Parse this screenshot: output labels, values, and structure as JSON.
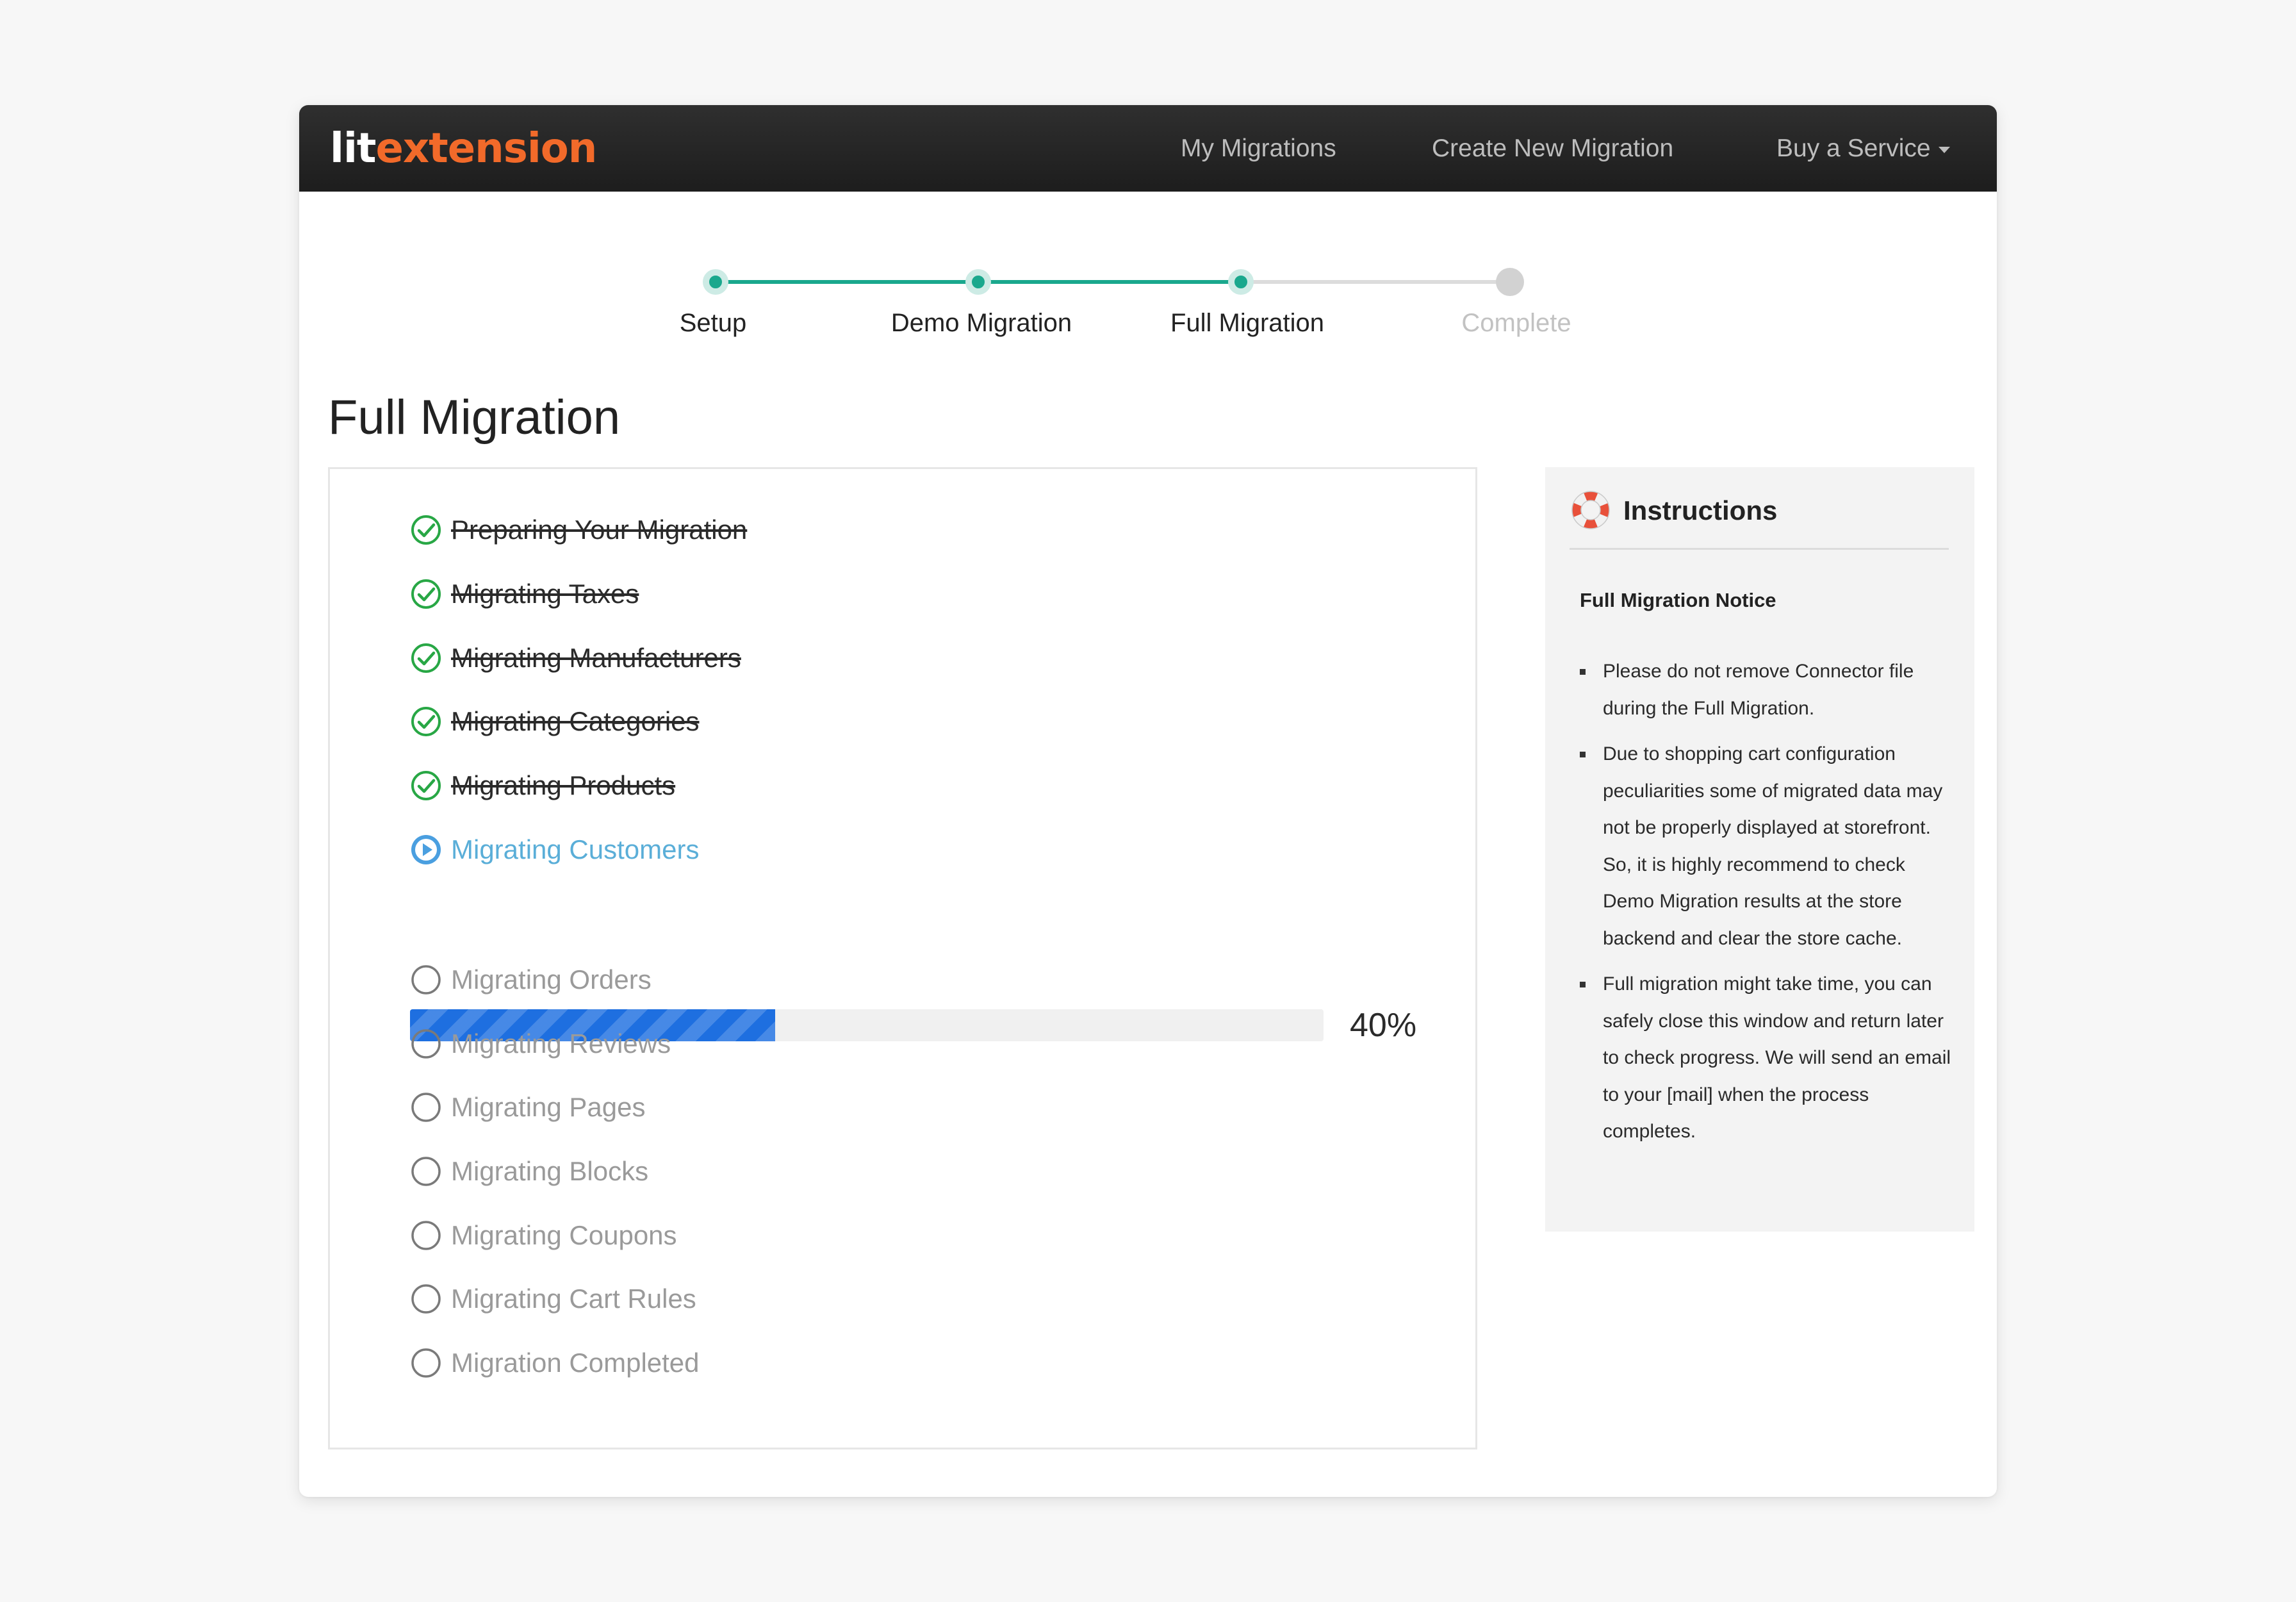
{
  "navbar": {
    "logo_prefix": "lit",
    "logo_suffix": "extension",
    "links": [
      "My Migrations",
      "Create New Migration",
      "Buy a Service"
    ]
  },
  "stepper": {
    "steps": [
      {
        "label": "Setup",
        "status": "done"
      },
      {
        "label": "Demo Migration",
        "status": "done"
      },
      {
        "label": "Full Migration",
        "status": "current"
      },
      {
        "label": "Complete",
        "status": "todo"
      }
    ]
  },
  "main": {
    "title": "Full Migration",
    "tasks": [
      {
        "label": "Preparing Your Migration",
        "status": "done"
      },
      {
        "label": "Migrating Taxes",
        "status": "done"
      },
      {
        "label": "Migrating Manufacturers",
        "status": "done"
      },
      {
        "label": "Migrating Categories",
        "status": "done"
      },
      {
        "label": "Migrating Products",
        "status": "done"
      },
      {
        "label": "Migrating Customers",
        "status": "active"
      },
      {
        "label": "Migrating Orders",
        "status": "pending"
      },
      {
        "label": "Migrating Reviews",
        "status": "pending"
      },
      {
        "label": "Migrating Pages",
        "status": "pending"
      },
      {
        "label": "Migrating Blocks",
        "status": "pending"
      },
      {
        "label": "Migrating Coupons",
        "status": "pending"
      },
      {
        "label": "Migrating Cart Rules",
        "status": "pending"
      },
      {
        "label": "Migration Completed",
        "status": "pending"
      }
    ],
    "progress": {
      "value": 0.4,
      "label": "40%"
    }
  },
  "instructions": {
    "title": "Instructions",
    "notice_title": "Full Migration Notice",
    "notes": [
      "Please do not remove Connector file during the Full Migration.",
      "Due to shopping cart configuration peculiarities some of migrated data may not be properly displayed at storefront. So, it is highly recommend to check Demo Migration results at the store backend and clear the store cache.",
      "Full migration might take time, you can safely close this window and return later to check progress. We will send an email to your [mail] when the process completes."
    ]
  },
  "colors": {
    "navbar_bg": "#1f1f1f",
    "logo_accent": "#f26a2a",
    "step_done": "#1aa88d",
    "step_todo": "#d2d2d2",
    "check_green": "#28a745",
    "active_blue": "#5aaed8",
    "progress_blue": "#1e6fe0"
  },
  "icons": {
    "done": "check-circle-icon",
    "active": "play-circle-icon",
    "pending": "empty-circle-icon",
    "instructions": "lifebuoy-icon"
  }
}
